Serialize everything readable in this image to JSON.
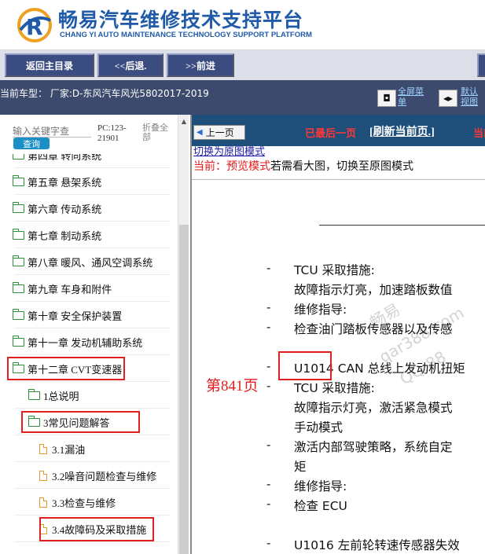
{
  "header": {
    "title_cn": "畅易汽车维修技术支持平台",
    "title_en": "CHANG YI AUTO MAINTENANCE TECHNOLOGY SUPPORT PLATFORM",
    "logo_letter": "R"
  },
  "nav": {
    "home": "返回主目录",
    "back": "<<后退.",
    "forward": ">>前进"
  },
  "infobar": {
    "car_model": "当前车型：  厂家:D-东风汽车风光5802017-2019",
    "fullscreen_label": "全屏菜单",
    "default_view_label": "默认视图"
  },
  "sidebar": {
    "search_placeholder": "输入关键字查",
    "search_button": "查询",
    "pc_code": "PC:123-21901",
    "collapse_all": "折叠全部",
    "items": [
      {
        "label": "第四章 转向系统",
        "level": 0,
        "icon": "folder"
      },
      {
        "label": "第五章 悬架系统",
        "level": 0,
        "icon": "folder"
      },
      {
        "label": "第六章 传动系统",
        "level": 0,
        "icon": "folder"
      },
      {
        "label": "第七章 制动系统",
        "level": 0,
        "icon": "folder"
      },
      {
        "label": "第八章 暖风、通风空调系统",
        "level": 0,
        "icon": "folder"
      },
      {
        "label": "第九章 车身和附件",
        "level": 0,
        "icon": "folder"
      },
      {
        "label": "第十章 安全保护装置",
        "level": 0,
        "icon": "folder"
      },
      {
        "label": "第十一章 发动机辅助系统",
        "level": 0,
        "icon": "folder"
      },
      {
        "label": "第十二章 CVT变速器",
        "level": 0,
        "icon": "folder-open"
      },
      {
        "label": "1总说明",
        "level": 1,
        "icon": "folder"
      },
      {
        "label": "3常见问题解答",
        "level": 1,
        "icon": "folder-open"
      },
      {
        "label": "3.1漏油",
        "level": 2,
        "icon": "doc"
      },
      {
        "label": "3.2噪音问题检查与维修",
        "level": 2,
        "icon": "doc"
      },
      {
        "label": "3.3检查与维修",
        "level": 2,
        "icon": "doc"
      },
      {
        "label": "3.4故障码及采取措施",
        "level": 2,
        "icon": "doc"
      }
    ]
  },
  "content": {
    "prev_page": "上一页",
    "last_page": "已最后一页",
    "refresh": "[刷新当前页.]",
    "current_edge": "当前",
    "switch_link": "切换为原图模式",
    "preview_prefix": "当前：预览模式",
    "preview_suffix": "若需看大图，切换至原图模式",
    "page_label": "第841页",
    "watermark_1": "畅易",
    "watermark_2": "qar388.com",
    "watermark_3": "QQ:88",
    "lines": [
      {
        "bullet": "-",
        "text": "TCU 采取措施:"
      },
      {
        "bullet": "",
        "text": "故障指示灯亮，加速踏板数值"
      },
      {
        "bullet": "-",
        "text": "维修指导:"
      },
      {
        "bullet": "-",
        "text": "检查油门踏板传感器以及传感"
      },
      {
        "bullet": "-",
        "text": "U1014 CAN 总线上发动机扭矩"
      },
      {
        "bullet": "-",
        "text": "TCU 采取措施:"
      },
      {
        "bullet": "",
        "text": "故障指示灯亮，激活紧急模式"
      },
      {
        "bullet": "",
        "text": "手动模式"
      },
      {
        "bullet": "-",
        "text": "激活内部驾驶策略，系统自定"
      },
      {
        "bullet": "",
        "text": "矩"
      },
      {
        "bullet": "-",
        "text": "维修指导:"
      },
      {
        "bullet": "-",
        "text": "检查 ECU"
      },
      {
        "bullet": "-",
        "text": "U1016 左前轮转速传感器失效"
      }
    ]
  }
}
